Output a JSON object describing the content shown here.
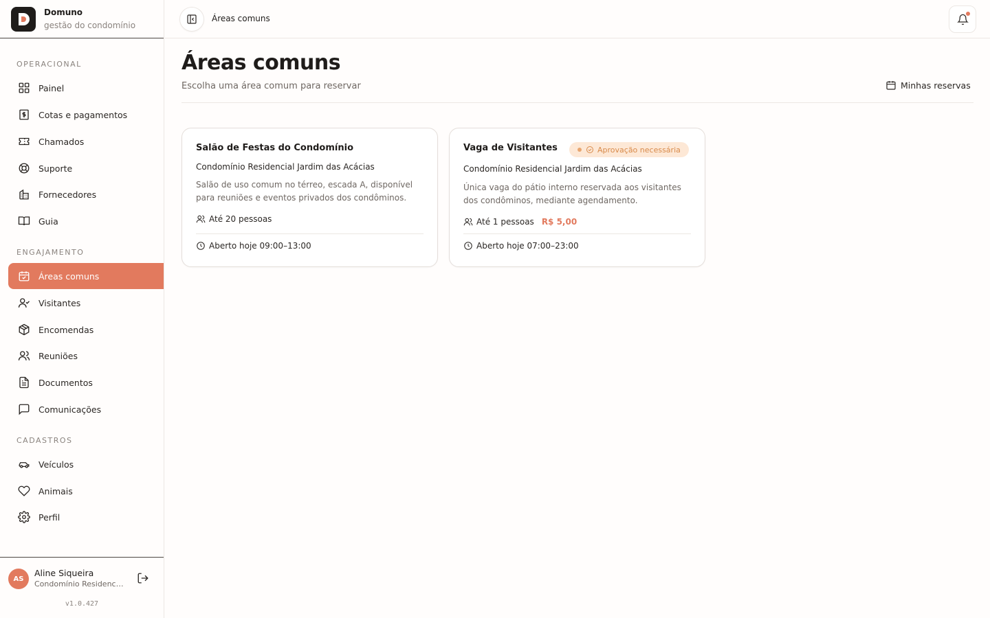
{
  "brand": {
    "name": "Domuno",
    "subtitle": "gestão do condomínio"
  },
  "sidebar": {
    "sections": [
      {
        "title": "OPERACIONAL"
      },
      {
        "title": "ENGAJAMENTO"
      },
      {
        "title": "CADASTROS"
      }
    ],
    "items": [
      {
        "label": "Painel",
        "icon": "grid-icon"
      },
      {
        "label": "Cotas e pagamentos",
        "icon": "receipt-icon"
      },
      {
        "label": "Chamados",
        "icon": "ticket-icon"
      },
      {
        "label": "Suporte",
        "icon": "lifebuoy-icon"
      },
      {
        "label": "Fornecedores",
        "icon": "building-icon"
      },
      {
        "label": "Guia",
        "icon": "book-icon"
      },
      {
        "label": "Áreas comuns",
        "icon": "calendar-check-icon",
        "active": true
      },
      {
        "label": "Visitantes",
        "icon": "user-check-icon"
      },
      {
        "label": "Encomendas",
        "icon": "package-icon"
      },
      {
        "label": "Reuniões",
        "icon": "users-icon"
      },
      {
        "label": "Documentos",
        "icon": "file-text-icon"
      },
      {
        "label": "Comunicações",
        "icon": "message-square-icon"
      },
      {
        "label": "Veículos",
        "icon": "car-icon"
      },
      {
        "label": "Animais",
        "icon": "heart-icon"
      },
      {
        "label": "Perfil",
        "icon": "gear-icon"
      }
    ]
  },
  "user": {
    "initials": "AS",
    "name": "Aline Siqueira",
    "org": "Condomínio Residencial Jardim das Acácias",
    "version": "v1.0.427"
  },
  "topbar": {
    "breadcrumb": "Áreas comuns"
  },
  "page": {
    "title": "Áreas comuns",
    "subtitle": "Escolha uma área comum para reservar",
    "my_reservations": "Minhas reservas"
  },
  "cards": [
    {
      "title": "Salão de Festas do Condomínio",
      "org": "Condomínio Residencial Jardim das Acácias",
      "description": "Salão de uso comum no térreo, escada A, disponível para reuniões e eventos privados dos condôminos.",
      "capacity": "Até 20 pessoas",
      "hours": "Aberto hoje 09:00–13:00"
    },
    {
      "title": "Vaga de Visitantes",
      "badge": "Aprovação necessária",
      "org": "Condomínio Residencial Jardim das Acácias",
      "description": "Única vaga do pátio interno reservada aos visitantes dos condôminos, mediante agendamento.",
      "capacity": "Até 1 pessoas",
      "price": "R$ 5,00",
      "hours": "Aberto hoje 07:00–23:00"
    }
  ],
  "colors": {
    "accent": "#e27a5e",
    "badge_bg": "#fde8d6",
    "badge_text": "#d88a4a"
  }
}
